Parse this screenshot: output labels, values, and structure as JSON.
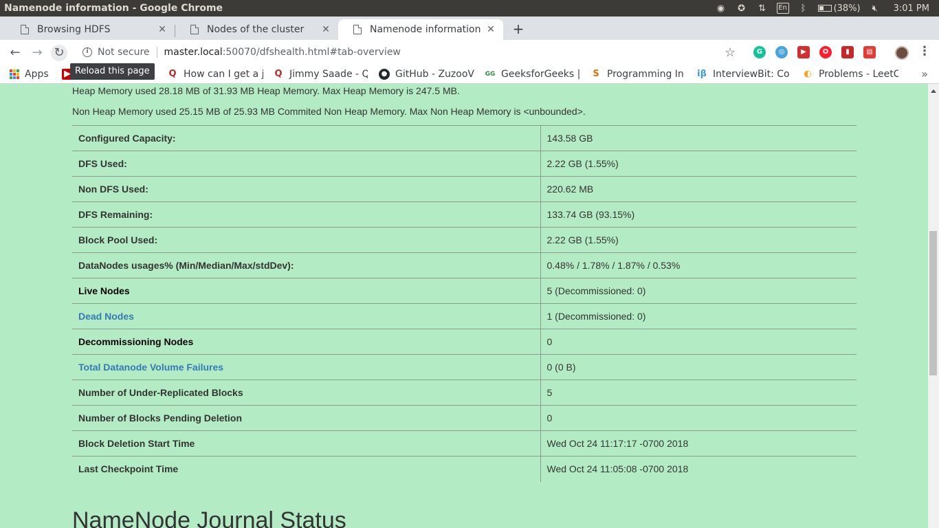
{
  "os": {
    "window_title": "Namenode information - Google Chrome",
    "battery": "(38%)",
    "clock": "3:01 PM",
    "keyboard": "En"
  },
  "tabs": [
    {
      "label": "Browsing HDFS"
    },
    {
      "label": "Nodes of the cluster"
    },
    {
      "label": "Namenode information"
    }
  ],
  "toolbar": {
    "security_label": "Not secure",
    "url_host": "master.local",
    "url_rest": ":50070/dfshealth.html#tab-overview",
    "reload_tooltip": "Reload this page"
  },
  "bookmarks": [
    {
      "label": "Apps"
    },
    {
      "label": "How can I get a j"
    },
    {
      "label": "Jimmy Saade - Q"
    },
    {
      "label": "GitHub - ZuzooV"
    },
    {
      "label": "GeeksforGeeks |"
    },
    {
      "label": "Programming In"
    },
    {
      "label": "InterviewBit: Co"
    },
    {
      "label": "Problems - LeetC"
    }
  ],
  "page": {
    "heap_memory": "Heap Memory used 28.18 MB of 31.93 MB Heap Memory. Max Heap Memory is 247.5 MB.",
    "non_heap_memory": "Non Heap Memory used 25.15 MB of 25.93 MB Commited Non Heap Memory. Max Non Heap Memory is <unbounded>.",
    "rows": [
      {
        "key": "Configured Capacity:",
        "value": "143.58 GB"
      },
      {
        "key": "DFS Used:",
        "value": "2.22 GB (1.55%)"
      },
      {
        "key": "Non DFS Used:",
        "value": "220.62 MB"
      },
      {
        "key": "DFS Remaining:",
        "value": "133.74 GB (93.15%)"
      },
      {
        "key": "Block Pool Used:",
        "value": "2.22 GB (1.55%)"
      },
      {
        "key": "DataNodes usages% (Min/Median/Max/stdDev):",
        "value": "0.48% / 1.78% / 1.87% / 0.53%"
      },
      {
        "key": "Live Nodes",
        "value": "5 (Decommissioned: 0)"
      },
      {
        "key": "Dead Nodes",
        "value": "1 (Decommissioned: 0)"
      },
      {
        "key": "Decommissioning Nodes",
        "value": "0"
      },
      {
        "key": "Total Datanode Volume Failures",
        "value": "0 (0 B)"
      },
      {
        "key": "Number of Under-Replicated Blocks",
        "value": "5"
      },
      {
        "key": "Number of Blocks Pending Deletion",
        "value": "0"
      },
      {
        "key": "Block Deletion Start Time",
        "value": "Wed Oct 24 11:17:17 -0700 2018"
      },
      {
        "key": "Last Checkpoint Time",
        "value": "Wed Oct 24 11:05:08 -0700 2018"
      }
    ],
    "journal_heading": "NameNode Journal Status"
  },
  "colors": {
    "page_background": "#b3ecc4",
    "link": "#337ab7",
    "text": "#333333"
  }
}
